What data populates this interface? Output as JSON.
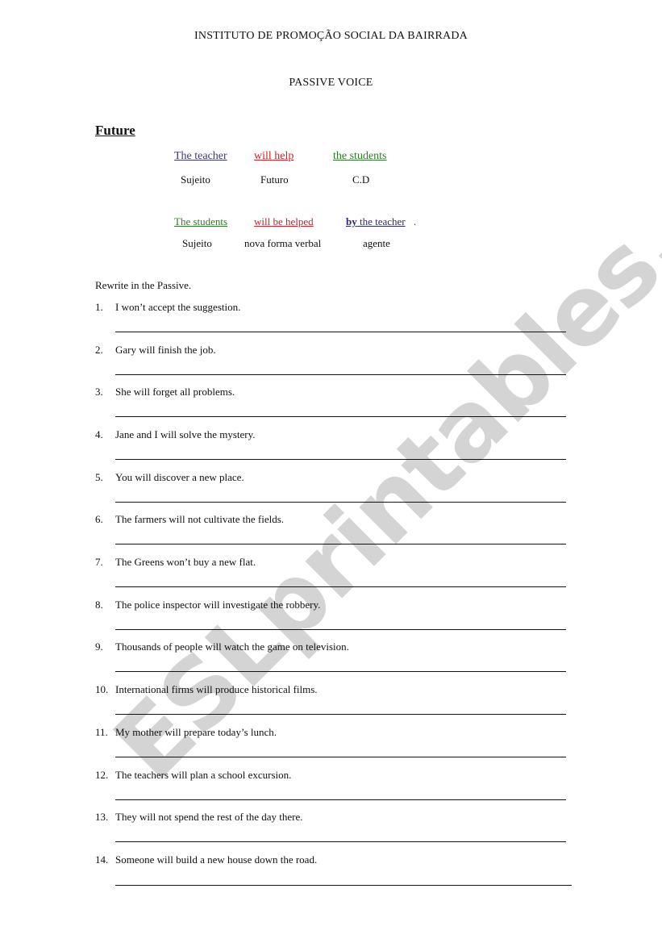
{
  "header": {
    "institution": "INSTITUTO DE PROMOÇÃO SOCIAL DA BAIRRADA",
    "title": "PASSIVE VOICE"
  },
  "section": {
    "heading": "Future"
  },
  "active_example": {
    "subject": "The teacher",
    "verb": "will help",
    "object": "the students",
    "labels": [
      "Sujeito",
      "Futuro",
      "C.D"
    ]
  },
  "passive_example": {
    "subject": "The students",
    "verb": "will be helped",
    "agent_by": "by",
    "agent_rest": " the teacher",
    "agent_period": ".",
    "labels": [
      "Sujeito",
      "nova forma verbal",
      "agente"
    ]
  },
  "colors": {
    "subject_blue": "#3b3a78",
    "verb_red": "#d0202a",
    "object_green": "#2f7a2a",
    "watermark": "#c8c8c8"
  },
  "exercise": {
    "instruction": "Rewrite in the Passive.",
    "items": [
      {
        "num": "1.",
        "text": "I won’t accept the suggestion."
      },
      {
        "num": "2.",
        "text": "Gary will finish the job."
      },
      {
        "num": "3.",
        "text": "She will forget all problems."
      },
      {
        "num": "4.",
        "text": "Jane and I will solve the mystery."
      },
      {
        "num": "5.",
        "text": "You will discover a new place."
      },
      {
        "num": "6.",
        "text": "The farmers will not cultivate the fields."
      },
      {
        "num": "7.",
        "text": "The Greens won’t buy a new flat."
      },
      {
        "num": "8.",
        "text": "The police inspector will investigate the robbery."
      },
      {
        "num": "9.",
        "text": "Thousands of people will watch the game on television."
      },
      {
        "num": "10.",
        "text": "International firms will produce historical films."
      },
      {
        "num": "11.",
        "text": "My mother will prepare today’s lunch."
      },
      {
        "num": "12.",
        "text": "The teachers will plan a school excursion."
      },
      {
        "num": "13.",
        "text": "They will not spend the rest of the day there."
      },
      {
        "num": "14.",
        "text": "Someone will build a new house down the road."
      }
    ]
  },
  "watermark": {
    "text": "ESLprintables.com"
  }
}
